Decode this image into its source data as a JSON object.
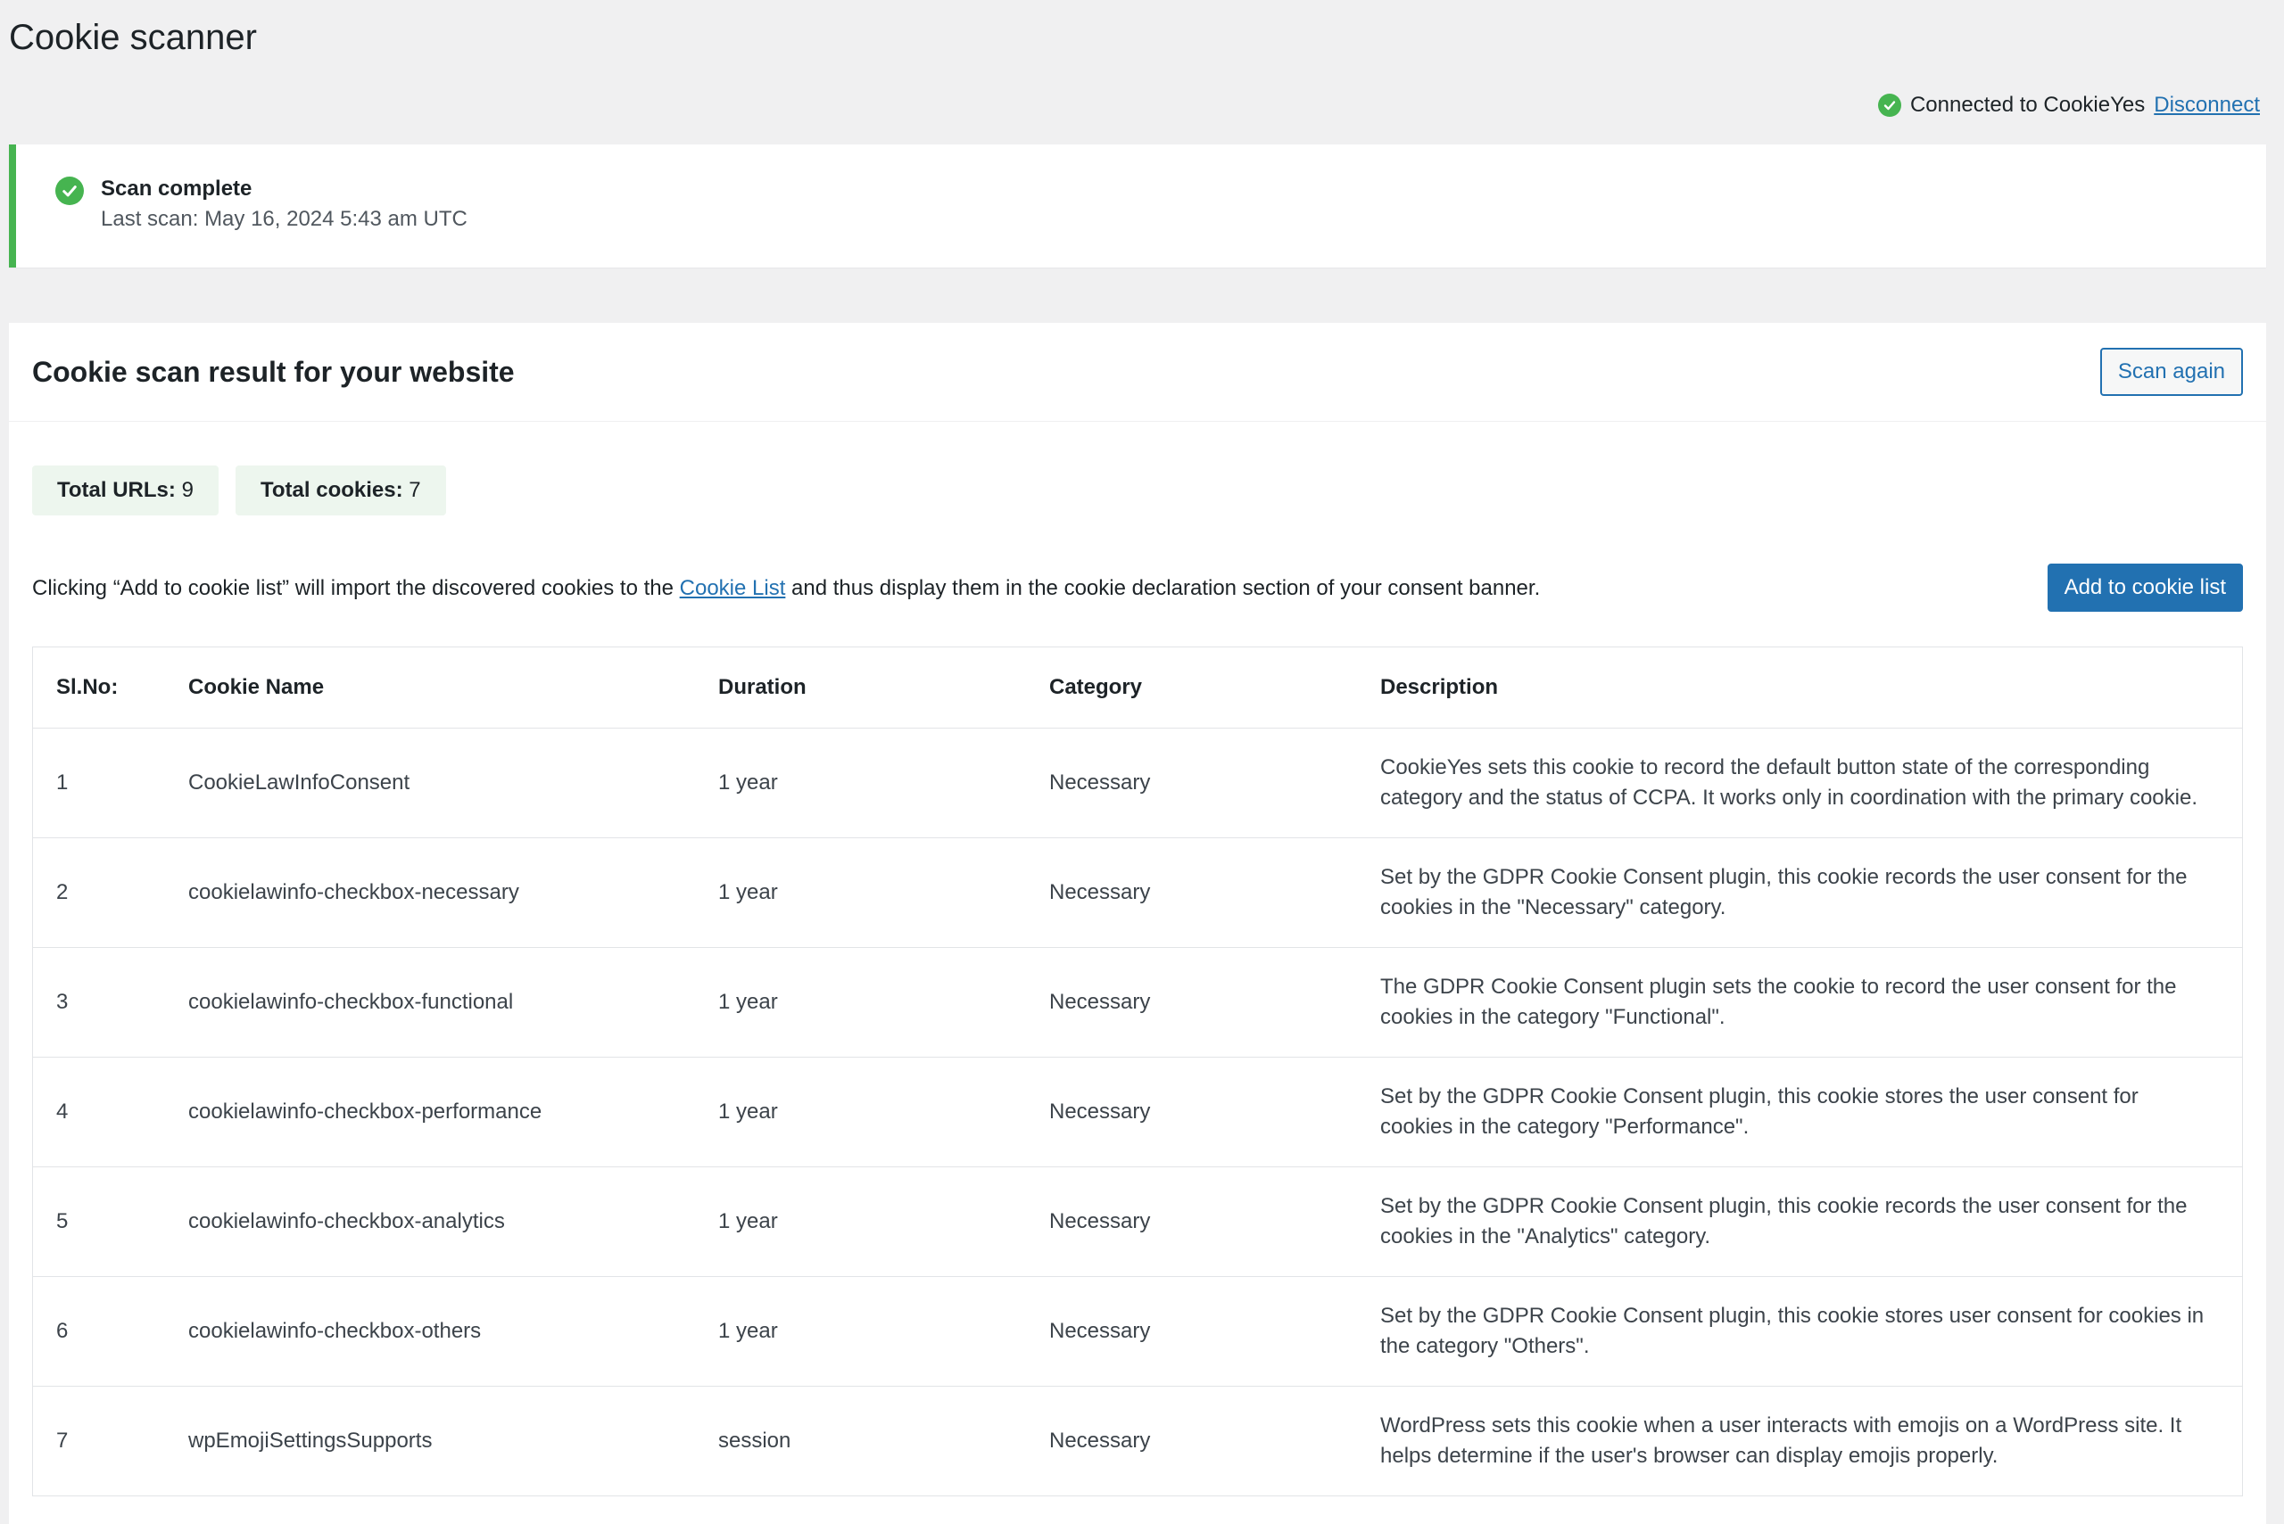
{
  "page": {
    "title": "Cookie scanner"
  },
  "connection": {
    "status_text": "Connected to CookieYes",
    "disconnect_label": "Disconnect",
    "icon": "check-circle-icon",
    "color": "#46b450"
  },
  "notice": {
    "title": "Scan complete",
    "subtitle": "Last scan: May 16, 2024 5:43 am UTC"
  },
  "results": {
    "heading": "Cookie scan result for your website",
    "scan_again_label": "Scan again",
    "stats": {
      "urls_label": "Total URLs:",
      "urls_value": "9",
      "cookies_label": "Total cookies:",
      "cookies_value": "7"
    },
    "info_prefix": "Clicking “Add to cookie list” will import the discovered cookies to the ",
    "info_link": "Cookie List",
    "info_suffix": " and thus display them in the cookie declaration section of your consent banner.",
    "add_button_label": "Add to cookie list",
    "columns": [
      "Sl.No:",
      "Cookie Name",
      "Duration",
      "Category",
      "Description"
    ],
    "rows": [
      {
        "no": "1",
        "name": "CookieLawInfoConsent",
        "duration": "1 year",
        "category": "Necessary",
        "description": "CookieYes sets this cookie to record the default button state of the corresponding category and the status of CCPA. It works only in coordination with the primary cookie."
      },
      {
        "no": "2",
        "name": "cookielawinfo-checkbox-necessary",
        "duration": "1 year",
        "category": "Necessary",
        "description": "Set by the GDPR Cookie Consent plugin, this cookie records the user consent for the cookies in the \"Necessary\" category."
      },
      {
        "no": "3",
        "name": "cookielawinfo-checkbox-functional",
        "duration": "1 year",
        "category": "Necessary",
        "description": "The GDPR Cookie Consent plugin sets the cookie to record the user consent for the cookies in the category \"Functional\"."
      },
      {
        "no": "4",
        "name": "cookielawinfo-checkbox-performance",
        "duration": "1 year",
        "category": "Necessary",
        "description": "Set by the GDPR Cookie Consent plugin, this cookie stores the user consent for cookies in the category \"Performance\"."
      },
      {
        "no": "5",
        "name": "cookielawinfo-checkbox-analytics",
        "duration": "1 year",
        "category": "Necessary",
        "description": "Set by the GDPR Cookie Consent plugin, this cookie records the user consent for the cookies in the \"Analytics\" category."
      },
      {
        "no": "6",
        "name": "cookielawinfo-checkbox-others",
        "duration": "1 year",
        "category": "Necessary",
        "description": "Set by the GDPR Cookie Consent plugin, this cookie stores user consent for cookies in the category \"Others\"."
      },
      {
        "no": "7",
        "name": "wpEmojiSettingsSupports",
        "duration": "session",
        "category": "Necessary",
        "description": "WordPress sets this cookie when a user interacts with emojis on a WordPress site. It helps determine if the user's browser can display emojis properly."
      }
    ]
  },
  "colors": {
    "accent": "#2271b1",
    "success": "#46b450",
    "stat_bg": "#edf6ee",
    "page_bg": "#f0f0f1"
  }
}
